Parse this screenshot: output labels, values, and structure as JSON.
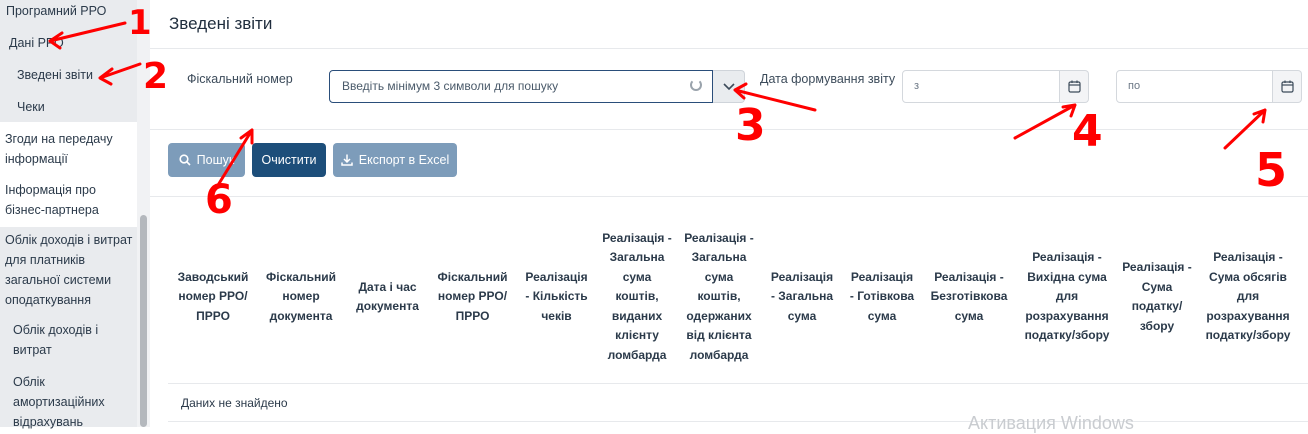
{
  "sidebar": {
    "items": [
      {
        "label": "Програмний РРО"
      },
      {
        "label": "Дані РРО"
      },
      {
        "label": "Зведені звіти"
      },
      {
        "label": "Чеки"
      },
      {
        "label": "Згоди на передачу інформації"
      },
      {
        "label": "Інформація про бізнес-партнера"
      },
      {
        "label": "Облік доходів і витрат для платників загальної системи оподаткування"
      },
      {
        "label": "Облік доходів і витрат"
      },
      {
        "label": "Облік амортизаційних відрахувань"
      }
    ]
  },
  "page": {
    "title": "Зведені звіти"
  },
  "filters": {
    "fiscal_label": "Фіскальний номер",
    "fiscal_placeholder": "Введіть мінімум 3 символи для пошуку",
    "date_label": "Дата формування звіту",
    "date_from": "з",
    "date_to": "по"
  },
  "buttons": {
    "search": "Пошук",
    "clear": "Очистити",
    "export": "Експорт в Excel"
  },
  "table": {
    "headers": [
      "Заводський номер РРО/ПРРО",
      "Фіскальний номер документа",
      "Дата і час документа",
      "Фіскальний номер РРО/ПРРО",
      "Реалізація - Кількість чеків",
      "Реалізація - Загальна сума коштів, виданих клієнту ломбарда",
      "Реалізація - Загальна сума коштів, одержаних від клієнта ломбарда",
      "Реалізація - Загальна сума",
      "Реалізація - Готівкова сума",
      "Реалізація - Безготівкова сума",
      "Реалізація - Вихідна сума для розрахування податку/збору",
      "Реалізація - Сума податку/збору",
      "Реалізація - Сума обсягів для розрахування податку/збору"
    ],
    "empty_text": "Даних не знайдено"
  },
  "annotations": [
    "1",
    "2",
    "3",
    "4",
    "5",
    "6"
  ],
  "watermark": "Активация Windows",
  "colors": {
    "primary_dark": "#1d4e7a",
    "primary_muted": "#7d9cba",
    "annotation_red": "#ff0000",
    "sidebar_active_bg": "#e9ebee"
  }
}
